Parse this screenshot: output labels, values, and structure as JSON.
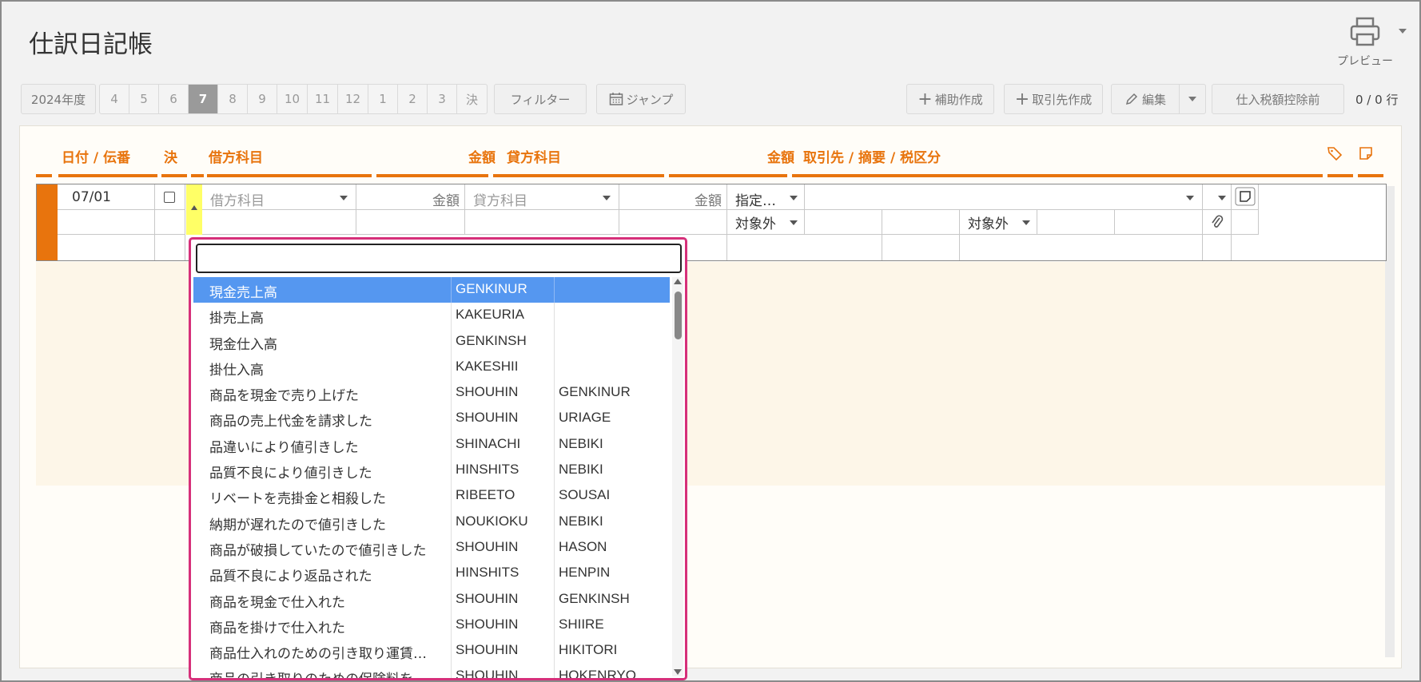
{
  "page": {
    "title": "仕訳日記帳"
  },
  "preview": {
    "label": "プレビュー"
  },
  "toolbar": {
    "year": "2024年度",
    "months": [
      "4",
      "5",
      "6",
      "7",
      "8",
      "9",
      "10",
      "11",
      "12",
      "1",
      "2",
      "3",
      "決"
    ],
    "active_month": "7",
    "filter": "フィルター",
    "jump": "ジャンプ",
    "add_aux": "補助作成",
    "add_partner": "取引先作成",
    "edit": "編集",
    "tax_mode": "仕入税額控除前",
    "row_count": "0 / 0 行"
  },
  "headers": {
    "date": "日付 / 伝番",
    "closing": "決",
    "debit_account": "借方科目",
    "debit_amount": "金額",
    "credit_account": "貸方科目",
    "credit_amount": "金額",
    "partner": "取引先 / 摘要 / 税区分"
  },
  "entry": {
    "date": "07/01",
    "debit_placeholder": "借方科目",
    "debit_amount_placeholder": "金額",
    "credit_placeholder": "貸方科目",
    "credit_amount_placeholder": "金額",
    "partner_select": "指定…",
    "tax1": "対象外",
    "tax2": "対象外"
  },
  "dropdown": {
    "search_value": "",
    "items": [
      {
        "name": "現金売上高",
        "code1": "GENKINUR",
        "code2": ""
      },
      {
        "name": "掛売上高",
        "code1": "KAKEURIA",
        "code2": ""
      },
      {
        "name": "現金仕入高",
        "code1": "GENKINSH",
        "code2": ""
      },
      {
        "name": "掛仕入高",
        "code1": "KAKESHII",
        "code2": ""
      },
      {
        "name": "商品を現金で売り上げた",
        "code1": "SHOUHIN",
        "code2": "GENKINUR"
      },
      {
        "name": "商品の売上代金を請求した",
        "code1": "SHOUHIN",
        "code2": "URIAGE"
      },
      {
        "name": "品違いにより値引きした",
        "code1": "SHINACHI",
        "code2": "NEBIKI"
      },
      {
        "name": "品質不良により値引きした",
        "code1": "HINSHITS",
        "code2": "NEBIKI"
      },
      {
        "name": "リベートを売掛金と相殺した",
        "code1": "RIBEETO",
        "code2": "SOUSAI"
      },
      {
        "name": "納期が遅れたので値引きした",
        "code1": "NOUKIOKU",
        "code2": "NEBIKI"
      },
      {
        "name": "商品が破損していたので値引きした",
        "code1": "SHOUHIN",
        "code2": "HASON"
      },
      {
        "name": "品質不良により返品された",
        "code1": "HINSHITS",
        "code2": "HENPIN"
      },
      {
        "name": "商品を現金で仕入れた",
        "code1": "SHOUHIN",
        "code2": "GENKINSH"
      },
      {
        "name": "商品を掛けで仕入れた",
        "code1": "SHOUHIN",
        "code2": "SHIIRE"
      },
      {
        "name": "商品仕入れのための引き取り運賃…",
        "code1": "SHOUHIN",
        "code2": "HIKITORI"
      },
      {
        "name": "商品の引き取りのための保険料を…",
        "code1": "SHOUHIN",
        "code2": "HOKENRYO"
      }
    ]
  }
}
